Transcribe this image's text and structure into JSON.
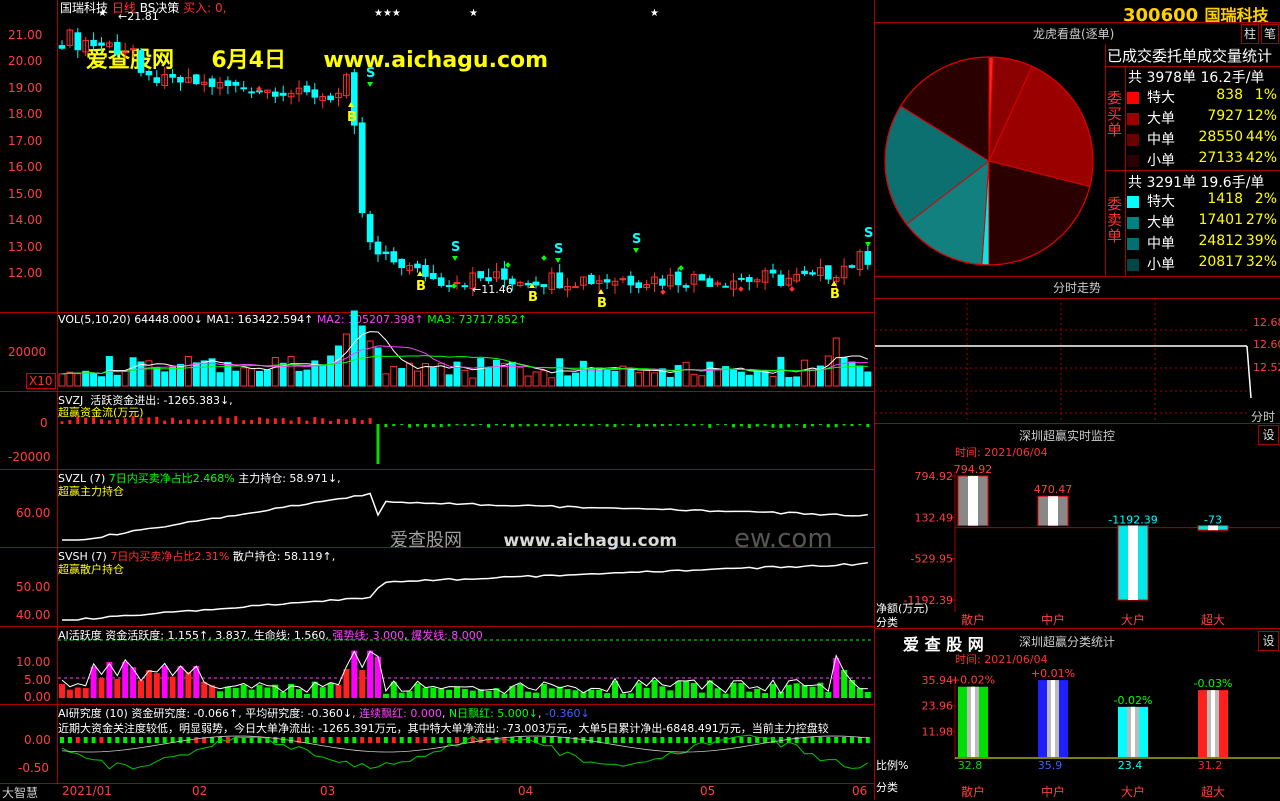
{
  "main": {
    "stock_name": "国瑞科技",
    "period": "日线",
    "indicator": "BS决策",
    "buy_label": "买入: 0,",
    "stars": [
      "★",
      "★★★",
      "★",
      "★"
    ],
    "watermark_site": "爱查股网",
    "watermark_date": "6月4日",
    "watermark_url": "www.aichagu.com",
    "high_label": "←21.81",
    "low_label": "←11.46",
    "y_ticks": [
      "21.00",
      "20.00",
      "19.00",
      "18.00",
      "17.00",
      "16.00",
      "15.00",
      "14.00",
      "13.00",
      "12.00"
    ],
    "markers": [
      "B",
      "B",
      "B",
      "B",
      "B",
      "B",
      "S",
      "S",
      "S",
      "S",
      "S"
    ]
  },
  "vol": {
    "title": "VOL(5,10,20)",
    "vol": "64448.000↓",
    "ma1": "MA1: 163422.594↑",
    "ma2": "MA2: 105207.398↑",
    "ma3": "MA3: 73717.852↑",
    "y_tick": "20000",
    "unit": "X10"
  },
  "svzj": {
    "title": "SVZJ",
    "text": "活跃资金进出: -1265.383↓,",
    "subtitle": "超赢资金流(万元)",
    "y_ticks": [
      "0",
      "-20000"
    ]
  },
  "svzl": {
    "title": "SVZL (7)",
    "text1": "7日内买卖净占比2.468%",
    "text2": "主力持仓: 58.971↓,",
    "subtitle": "超赢主力持仓",
    "y_tick": "60.00",
    "wm1": "爱查股网",
    "wm2": "www.aichagu.com",
    "wm3": "ew.com"
  },
  "svsh": {
    "title": "SVSH (7)",
    "text1": "7日内买卖净占比2.31%",
    "text2": "散户持仓: 58.119↑,",
    "subtitle": "超赢散户持仓",
    "y_ticks": [
      "50.00",
      "40.00"
    ]
  },
  "ai_act": {
    "title": "AI活跃度",
    "t1": "资金活跃度: 1.155↑",
    "t2": "3.837",
    "t3": "生命线: 1.560",
    "t4": "强势线: 3.000",
    "t5": "爆发线: 8.000",
    "y_ticks": [
      "10.00",
      "5.00",
      "0.00"
    ]
  },
  "ai_res": {
    "title": "AI研究度 (10)",
    "t1": "资金研究度: -0.066↑",
    "t2": "平均研究度: -0.360↓",
    "t3": "连续飘红: 0.000",
    "t4": "N日飘红: 5.000↓",
    "t5": "-0.360↓",
    "desc": "近期大资金关注度较低，明显弱势，今日大单净流出: -1265.391万元，其中特大单净流出: -73.003万元，大单5日累计净出-6848.491万元，当前主力控盘较",
    "y_ticks": [
      "0.00",
      "-0.50"
    ]
  },
  "xaxis": {
    "corner": "大智慧",
    "labels": [
      "2021/01",
      "02",
      "03",
      "04",
      "05",
      "06"
    ]
  },
  "right": {
    "code": "300600",
    "name": "国瑞科技",
    "btn_zhu": "柱",
    "btn_bi": "笔",
    "pie_title": "龙虎看盘(逐单)",
    "stats_title": "已成交委托单成交量统计",
    "buy_side": "委买单",
    "sell_side": "委卖单",
    "buy_total": "共 3978单 16.2手/单",
    "sell_total": "共 3291单 19.6手/单",
    "buy_rows": [
      {
        "label": "特大",
        "value": "838",
        "pct": "1%"
      },
      {
        "label": "大单",
        "value": "7927",
        "pct": "12%"
      },
      {
        "label": "中单",
        "value": "28550",
        "pct": "44%"
      },
      {
        "label": "小单",
        "value": "27133",
        "pct": "42%"
      }
    ],
    "sell_rows": [
      {
        "label": "特大",
        "value": "1418",
        "pct": "2%"
      },
      {
        "label": "大单",
        "value": "17401",
        "pct": "27%"
      },
      {
        "label": "中单",
        "value": "24812",
        "pct": "39%"
      },
      {
        "label": "小单",
        "value": "20817",
        "pct": "32%"
      }
    ],
    "buy_colors": [
      "#ff0000",
      "#990000",
      "#6a0000",
      "#2a0000"
    ],
    "sell_colors": [
      "#00ffff",
      "#008080",
      "#007070",
      "#004848"
    ],
    "intraday_title": "分时走势",
    "intraday_ticks": [
      "12.68",
      "12.60",
      "12.52",
      "分时"
    ],
    "realtime_title": "深圳超赢实时监控",
    "settings": "设",
    "time_label": "时间: 2021/06/04",
    "rt_y_ticks": [
      "794.92",
      "132.49",
      "-529.95",
      "-1192.39"
    ],
    "rt_values": [
      "794.92",
      "470.47",
      "-1192.39",
      "-73"
    ],
    "rt_ylabel": "净额(万元)",
    "category_label": "分类",
    "categories": [
      "散户",
      "中户",
      "大户",
      "超大"
    ],
    "cls_title": "深圳超赢分类统计",
    "brand": "爱 查 股 网",
    "cls_y_ticks": [
      "35.94",
      "23.96",
      "11.98"
    ],
    "cls_top_labels": [
      "+0.02%",
      "+0.01%",
      "-0.02%",
      "-0.03%"
    ],
    "cls_bottom_values": [
      "32.8",
      "35.9",
      "23.4",
      "31.2"
    ],
    "ratio_label": "比例%"
  },
  "chart_data": [
    {
      "type": "bar",
      "title": "深圳超赢实时监控",
      "ylabel": "净额(万元)",
      "categories": [
        "散户",
        "中户",
        "大户",
        "超大"
      ],
      "values": [
        794.92,
        470.47,
        -1192.39,
        -73
      ],
      "ylim": [
        -1192.39,
        794.92
      ]
    },
    {
      "type": "bar",
      "title": "深圳超赢分类统计",
      "ylabel": "比例%",
      "categories": [
        "散户",
        "中户",
        "大户",
        "超大"
      ],
      "values": [
        32.8,
        35.9,
        23.4,
        31.2
      ],
      "ylim": [
        0,
        35.94
      ]
    },
    {
      "type": "pie",
      "title": "龙虎看盘(逐单)",
      "categories": [
        "委买特大",
        "委买大单",
        "委买中单",
        "委买小单",
        "委卖特大",
        "委卖大单",
        "委卖中单",
        "委卖小单"
      ],
      "values": [
        838,
        7927,
        28550,
        27133,
        1418,
        17401,
        24812,
        20817
      ]
    }
  ]
}
